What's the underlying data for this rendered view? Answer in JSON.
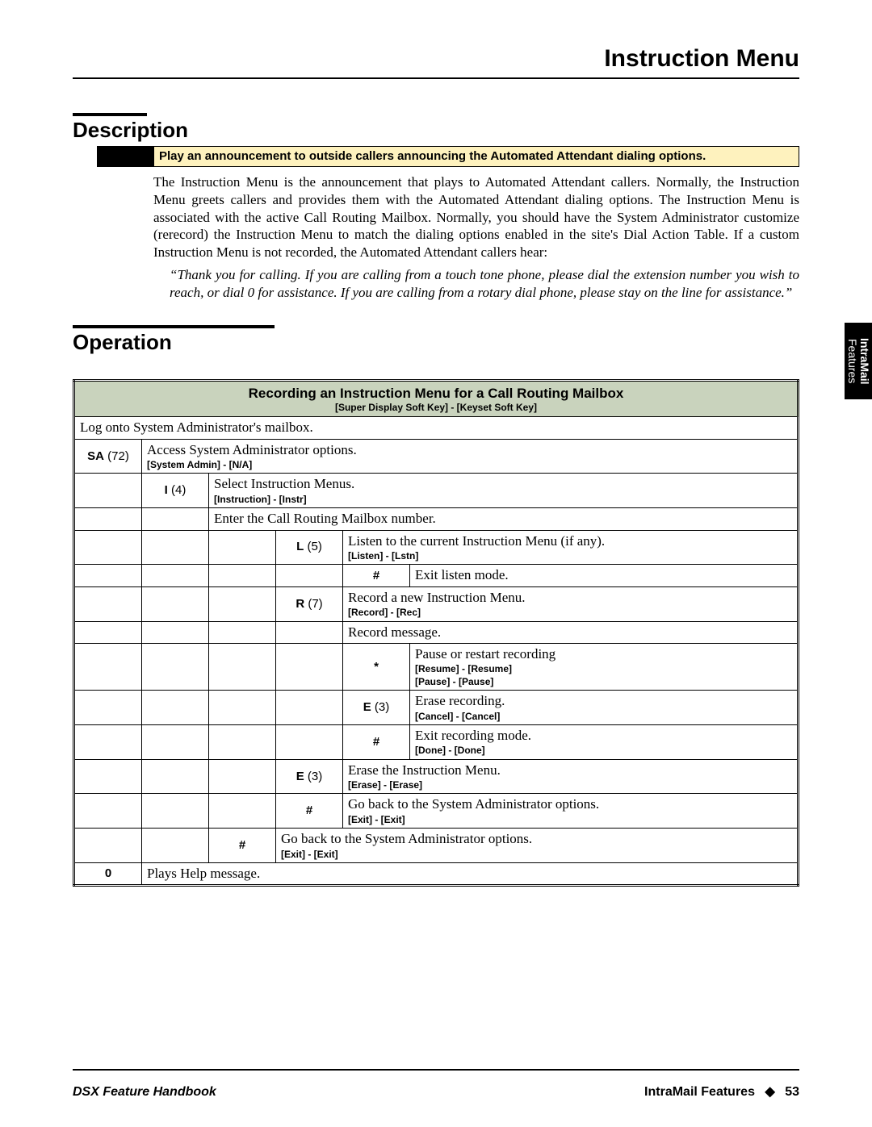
{
  "header": {
    "title": "Instruction Menu"
  },
  "sections": {
    "description": {
      "heading": "Description",
      "callout": "Play an announcement to outside callers announcing the Automated Attendant dialing options.",
      "body": "The Instruction Menu is the announcement that plays to Automated Attendant callers. Normally, the Instruction Menu greets callers and provides them with the Automated Attendant dialing options. The Instruction Menu is associated with the active Call Routing Mailbox. Normally, you should have the System Administrator customize (rerecord) the Instruction Menu to match the dialing options enabled in the site's Dial Action Table. If a custom Instruction Menu is not recorded, the Automated Attendant callers hear:",
      "quote": "“Thank you for calling. If you are calling from a touch tone phone, please dial the extension number you wish to reach, or dial 0 for assistance. If you are calling from a rotary dial phone, please stay on the line for assistance.”"
    },
    "operation": {
      "heading": "Operation"
    }
  },
  "side_tab": {
    "line1": "IntraMail",
    "line2": "Features"
  },
  "table": {
    "title": "Recording an Instruction Menu for a Call Routing Mailbox",
    "subtitle": "[Super Display Soft Key] - [Keyset Soft Key]",
    "rows": {
      "r0": "Log onto System Administrator's mailbox.",
      "r1_key_bold": "SA",
      "r1_key_num": "(72)",
      "r1_desc": "Access System Administrator options.",
      "r1_soft": "[System Admin] - [N/A]",
      "r2_key_bold": "I",
      "r2_key_num": "(4)",
      "r2_desc": "Select Instruction Menus.",
      "r2_soft": "[Instruction] - [Instr]",
      "r3_desc": "Enter the Call Routing Mailbox number.",
      "r4_key_bold": "L",
      "r4_key_num": "(5)",
      "r4_desc": "Listen to the current Instruction Menu (if any).",
      "r4_soft": "[Listen] - [Lstn]",
      "r5_key": "#",
      "r5_desc": "Exit listen mode.",
      "r6_key_bold": "R",
      "r6_key_num": "(7)",
      "r6_desc": "Record a new Instruction Menu.",
      "r6_soft": "[Record] - [Rec]",
      "r7_desc": "Record message.",
      "r8_key": "*",
      "r8_desc": "Pause or restart recording",
      "r8_soft1": "[Resume] - [Resume]",
      "r8_soft2": "[Pause] - [Pause]",
      "r9_key_bold": "E",
      "r9_key_num": "(3)",
      "r9_desc": "Erase recording.",
      "r9_soft": "[Cancel] - [Cancel]",
      "r10_key": "#",
      "r10_desc": "Exit recording mode.",
      "r10_soft": "[Done] - [Done]",
      "r11_key_bold": "E",
      "r11_key_num": "(3)",
      "r11_desc": "Erase the Instruction Menu.",
      "r11_soft": "[Erase] - [Erase]",
      "r12_key": "#",
      "r12_desc": "Go back to the System Administrator options.",
      "r12_soft": "[Exit] - [Exit]",
      "r13_key": "#",
      "r13_desc": "Go back to the System Administrator options.",
      "r13_soft": "[Exit] - [Exit]",
      "r14_key": "0",
      "r14_desc": "Plays Help message."
    }
  },
  "footer": {
    "left": "DSX Feature Handbook",
    "right_label": "IntraMail Features",
    "sep": "◆",
    "page": "53"
  }
}
